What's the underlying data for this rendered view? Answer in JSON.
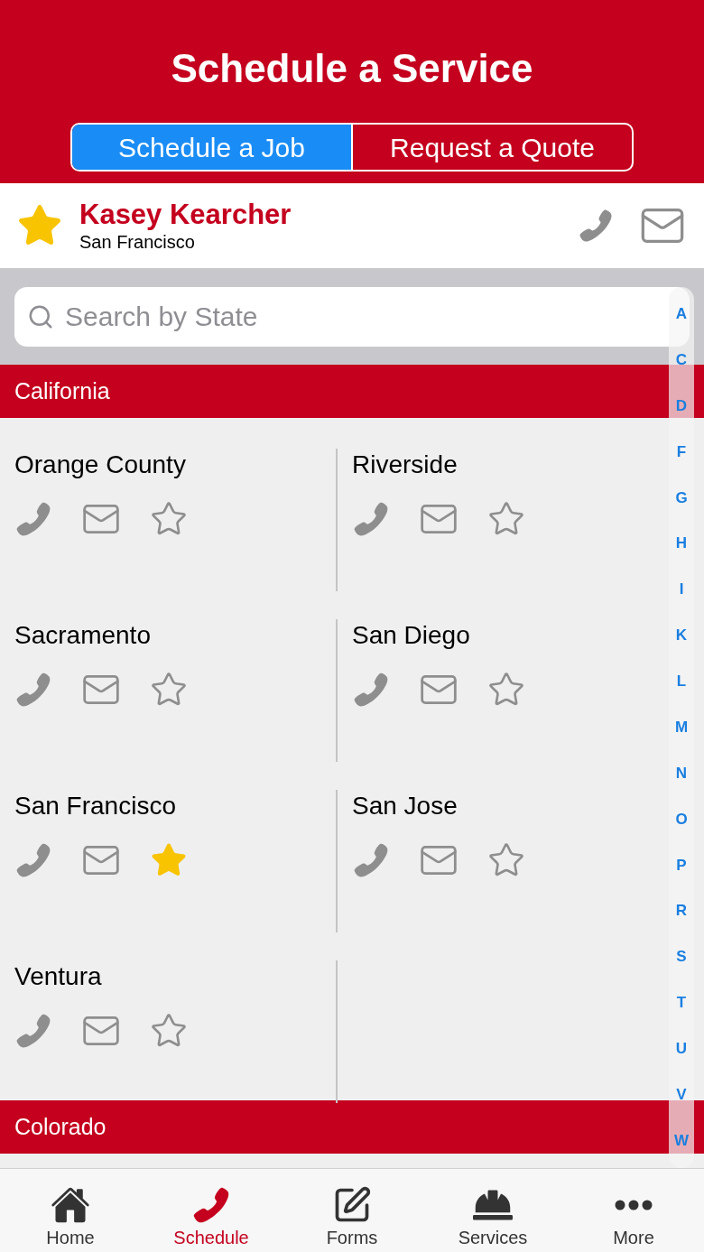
{
  "header": {
    "title": "Schedule a Service"
  },
  "segments": [
    {
      "label": "Schedule a Job",
      "selected": true
    },
    {
      "label": "Request a Quote",
      "selected": false
    }
  ],
  "profile": {
    "name": "Kasey Kearcher",
    "location": "San Francisco",
    "favorite": true
  },
  "search": {
    "placeholder": "Search by State"
  },
  "index_letters": [
    "A",
    "C",
    "D",
    "F",
    "G",
    "H",
    "I",
    "K",
    "L",
    "M",
    "N",
    "O",
    "P",
    "R",
    "S",
    "T",
    "U",
    "V",
    "W"
  ],
  "sections": [
    {
      "title": "California",
      "locations": [
        {
          "name": "Orange County",
          "favorite": false
        },
        {
          "name": "Riverside",
          "favorite": false
        },
        {
          "name": "Sacramento",
          "favorite": false
        },
        {
          "name": "San Diego",
          "favorite": false
        },
        {
          "name": "San Francisco",
          "favorite": true
        },
        {
          "name": "San Jose",
          "favorite": false
        },
        {
          "name": "Ventura",
          "favorite": false
        }
      ]
    },
    {
      "title": "Colorado"
    }
  ],
  "tab_bar": [
    {
      "label": "Home",
      "kind": "home",
      "selected": false
    },
    {
      "label": "Schedule",
      "kind": "schedule",
      "selected": true
    },
    {
      "label": "Forms",
      "kind": "forms",
      "selected": false
    },
    {
      "label": "Services",
      "kind": "services",
      "selected": false
    },
    {
      "label": "More",
      "kind": "more",
      "selected": false
    }
  ]
}
